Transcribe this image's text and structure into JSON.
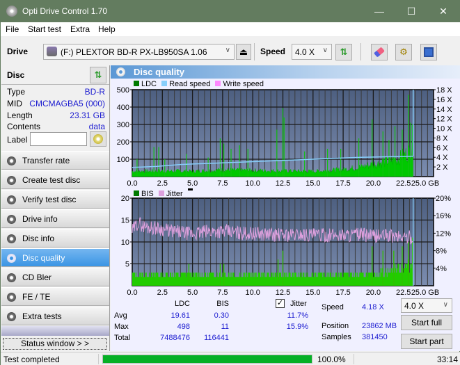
{
  "window": {
    "title": "Opti Drive Control 1.70",
    "controls": {
      "minimize": "—",
      "maximize": "☐",
      "close": "✕"
    }
  },
  "menu": [
    "File",
    "Start test",
    "Extra",
    "Help"
  ],
  "toolbar": {
    "drive_label": "Drive",
    "drive_value": "(F:)  PLEXTOR BD-R  PX-LB950SA 1.06",
    "speed_label": "Speed",
    "speed_value": "4.0 X",
    "icons": [
      "eject-icon",
      "refresh-icon",
      "erase-icon",
      "settings-icon",
      "save-icon"
    ]
  },
  "disc": {
    "header": "Disc",
    "fields": [
      {
        "key": "Type",
        "value": "BD-R"
      },
      {
        "key": "MID",
        "value": "CMCMAGBA5 (000)"
      },
      {
        "key": "Length",
        "value": "23.31 GB"
      },
      {
        "key": "Contents",
        "value": "data"
      }
    ],
    "label_key": "Label",
    "label_value": ""
  },
  "nav": [
    {
      "label": "Transfer rate",
      "active": false
    },
    {
      "label": "Create test disc",
      "active": false
    },
    {
      "label": "Verify test disc",
      "active": false
    },
    {
      "label": "Drive info",
      "active": false
    },
    {
      "label": "Disc info",
      "active": false
    },
    {
      "label": "Disc quality",
      "active": true
    },
    {
      "label": "CD Bler",
      "active": false
    },
    {
      "label": "FE / TE",
      "active": false
    },
    {
      "label": "Extra tests",
      "active": false
    }
  ],
  "status_window_button": "Status window > >",
  "panel": {
    "title": "Disc quality"
  },
  "chart_data": [
    {
      "type": "bar",
      "title": "LDC / Read speed",
      "legend": [
        {
          "name": "LDC",
          "color": "#007a00"
        },
        {
          "name": "Read speed",
          "color": "#87cefa"
        },
        {
          "name": "Write speed",
          "color": "#ff88ff"
        }
      ],
      "xlabel": "GB",
      "xlim": [
        0,
        25
      ],
      "x_ticks": [
        "0.0",
        "2.5",
        "5.0",
        "7.5",
        "10.0",
        "12.5",
        "15.0",
        "17.5",
        "20.0",
        "22.5",
        "25.0 GB"
      ],
      "ylim": [
        0,
        500
      ],
      "y_ticks": [
        "100",
        "200",
        "300",
        "400",
        "500"
      ],
      "y2lim": [
        0,
        18
      ],
      "y2_ticks": [
        "2 X",
        "4 X",
        "6 X",
        "8 X",
        "10 X",
        "12 X",
        "14 X",
        "16 X",
        "18 X"
      ],
      "data_end_gb": 23.31,
      "ldc_baseline_profile": [
        [
          0,
          30
        ],
        [
          2.5,
          32
        ],
        [
          5,
          30
        ],
        [
          7.5,
          38
        ],
        [
          10,
          35
        ],
        [
          12.5,
          32
        ],
        [
          15,
          30
        ],
        [
          17.5,
          40
        ],
        [
          19,
          55
        ],
        [
          20,
          70
        ],
        [
          21,
          85
        ],
        [
          22,
          100
        ],
        [
          23,
          140
        ],
        [
          23.31,
          150
        ]
      ],
      "ldc_spikes": [
        [
          0.4,
          100
        ],
        [
          1.8,
          170
        ],
        [
          2.2,
          170
        ],
        [
          2.7,
          100
        ],
        [
          4.5,
          130
        ],
        [
          6.3,
          110
        ],
        [
          7.3,
          220
        ],
        [
          7.6,
          190
        ],
        [
          8.2,
          160
        ],
        [
          8.9,
          180
        ],
        [
          9.6,
          160
        ],
        [
          12.0,
          270
        ],
        [
          12.5,
          395
        ],
        [
          12.6,
          340
        ],
        [
          14.3,
          145
        ],
        [
          16.2,
          160
        ],
        [
          17.3,
          160
        ],
        [
          18.8,
          220
        ],
        [
          19.9,
          330
        ],
        [
          20.8,
          260
        ],
        [
          21.3,
          210
        ],
        [
          21.8,
          290
        ],
        [
          22.4,
          270
        ],
        [
          22.9,
          470
        ],
        [
          23.1,
          310
        ],
        [
          23.25,
          300
        ]
      ],
      "read_speed_x": [
        [
          0,
          1.9
        ],
        [
          1,
          2.0
        ],
        [
          2,
          2.1
        ],
        [
          3,
          2.3
        ],
        [
          4,
          2.5
        ],
        [
          5,
          2.6
        ],
        [
          6,
          2.7
        ],
        [
          7,
          2.8
        ],
        [
          8,
          2.9
        ],
        [
          9,
          3.0
        ],
        [
          10,
          3.1
        ],
        [
          11,
          3.2
        ],
        [
          12,
          3.3
        ],
        [
          13,
          3.4
        ],
        [
          14,
          3.5
        ],
        [
          15,
          3.6
        ],
        [
          16,
          3.7
        ],
        [
          17,
          3.8
        ],
        [
          18,
          3.9
        ],
        [
          19,
          4.0
        ],
        [
          20,
          4.05
        ],
        [
          21,
          4.1
        ],
        [
          22,
          4.15
        ],
        [
          23.31,
          4.2
        ]
      ]
    },
    {
      "type": "bar",
      "title": "BIS / Jitter",
      "legend": [
        {
          "name": "BIS",
          "color": "#007a00"
        },
        {
          "name": "Jitter",
          "color": "#dda0dd"
        }
      ],
      "xlabel": "GB",
      "xlim": [
        0,
        25
      ],
      "x_ticks": [
        "0.0",
        "2.5",
        "5.0",
        "7.5",
        "10.0",
        "12.5",
        "15.0",
        "17.5",
        "20.0",
        "22.5",
        "25.0 GB"
      ],
      "ylim": [
        0,
        20
      ],
      "y_ticks": [
        "5",
        "10",
        "15",
        "20"
      ],
      "y2lim": [
        0,
        20
      ],
      "y2_ticks": [
        "4%",
        "8%",
        "12%",
        "16%",
        "20%"
      ],
      "data_end_gb": 23.31,
      "bis_baseline": 3,
      "bis_spikes": [
        [
          4.7,
          5
        ],
        [
          7.3,
          5
        ],
        [
          7.6,
          5
        ],
        [
          12.1,
          6
        ],
        [
          12.5,
          8
        ],
        [
          19.9,
          9
        ],
        [
          20.8,
          8
        ],
        [
          21.7,
          8
        ],
        [
          22.4,
          9
        ],
        [
          22.9,
          10
        ],
        [
          23.25,
          11
        ]
      ],
      "jitter_pct": [
        [
          0,
          12.5
        ],
        [
          0.5,
          14.5
        ],
        [
          1,
          13.5
        ],
        [
          2,
          13.2
        ],
        [
          3,
          12.6
        ],
        [
          4,
          12.2
        ],
        [
          5,
          11.8
        ],
        [
          6,
          12.3
        ],
        [
          7,
          12.5
        ],
        [
          8,
          12.3
        ],
        [
          9,
          12.0
        ],
        [
          10,
          11.9
        ],
        [
          11,
          11.8
        ],
        [
          12,
          11.6
        ],
        [
          13,
          11.6
        ],
        [
          14,
          11.7
        ],
        [
          15,
          11.6
        ],
        [
          16,
          11.5
        ],
        [
          17,
          11.6
        ],
        [
          18,
          11.6
        ],
        [
          19,
          11.7
        ],
        [
          20,
          11.3
        ],
        [
          21,
          11.5
        ],
        [
          22,
          11.2
        ],
        [
          23.31,
          11.0
        ]
      ]
    }
  ],
  "stats": {
    "headers": [
      "LDC",
      "BIS"
    ],
    "rows": [
      {
        "label": "Avg",
        "ldc": "19.61",
        "bis": "0.30",
        "jitter": "11.7%"
      },
      {
        "label": "Max",
        "ldc": "498",
        "bis": "11",
        "jitter": "15.9%"
      },
      {
        "label": "Total",
        "ldc": "7488476",
        "bis": "116441",
        "jitter": ""
      }
    ],
    "jitter_label": "Jitter",
    "jitter_checked": true,
    "speed_label": "Speed",
    "speed_value": "4.18 X",
    "position_label": "Position",
    "position_value": "23862 MB",
    "samples_label": "Samples",
    "samples_value": "381450",
    "speed_select": "4.0 X",
    "start_full": "Start full",
    "start_part": "Start part"
  },
  "statusbar": {
    "text": "Test completed",
    "progress_pct": 100,
    "progress_text": "100.0%",
    "time": "33:14"
  }
}
